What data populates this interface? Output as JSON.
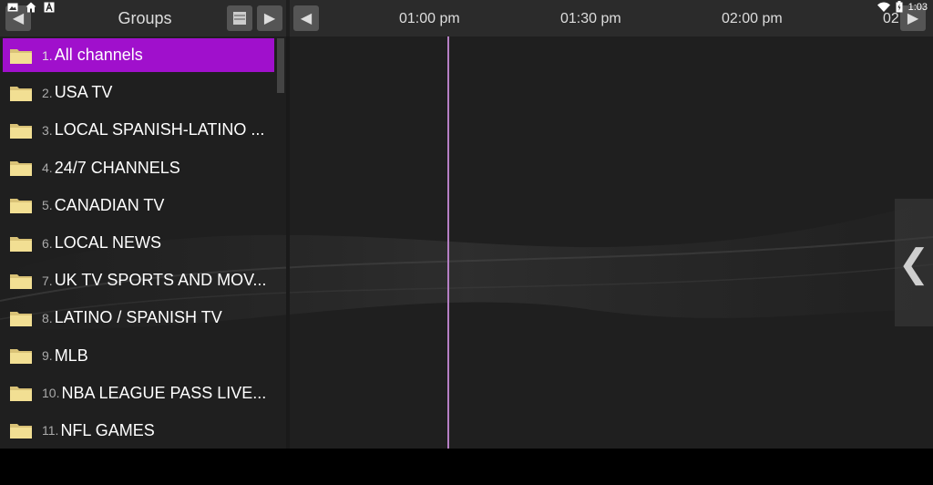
{
  "status_bar": {
    "left_icons": [
      "image-icon",
      "home-icon",
      "font-icon"
    ],
    "clock": "1:03"
  },
  "groups_panel": {
    "title": "Groups",
    "items": [
      {
        "num": "1.",
        "label": "All channels",
        "selected": true
      },
      {
        "num": "2.",
        "label": "USA TV"
      },
      {
        "num": "3.",
        "label": "LOCAL SPANISH-LATINO ..."
      },
      {
        "num": "4.",
        "label": "24/7 CHANNELS"
      },
      {
        "num": "5.",
        "label": "CANADIAN TV"
      },
      {
        "num": "6.",
        "label": "LOCAL NEWS"
      },
      {
        "num": "7.",
        "label": "UK TV SPORTS AND MOV..."
      },
      {
        "num": "8.",
        "label": "LATINO / SPANISH TV"
      },
      {
        "num": "9.",
        "label": "MLB"
      },
      {
        "num": "10.",
        "label": "NBA LEAGUE PASS LIVE..."
      },
      {
        "num": "11.",
        "label": "NFL GAMES"
      }
    ]
  },
  "timeline": {
    "times": [
      "01:00 pm",
      "01:30 pm",
      "02:00 pm",
      "02"
    ]
  },
  "colors": {
    "accent": "#a010cc",
    "now_line": "#b67fc5",
    "folder": "#f2df93"
  }
}
